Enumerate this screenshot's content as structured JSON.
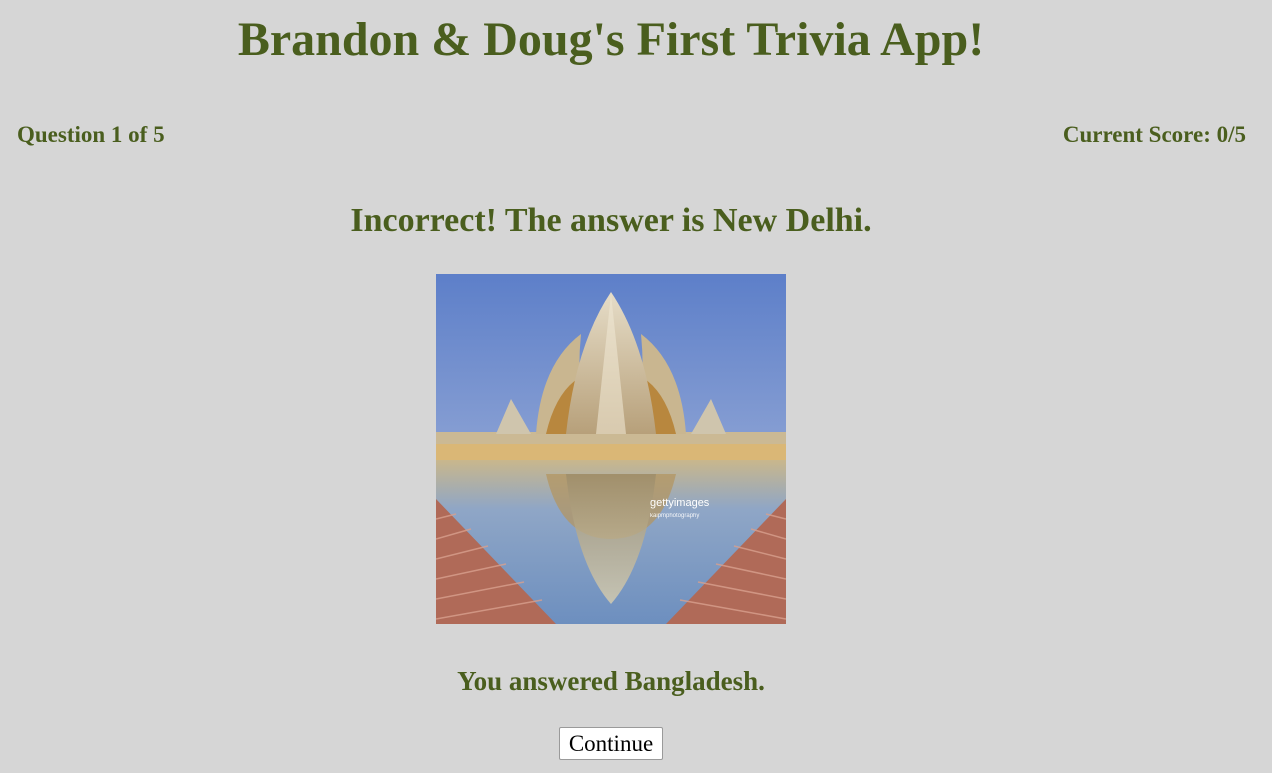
{
  "header": {
    "title": "Brandon & Doug's First Trivia App!"
  },
  "status": {
    "question_progress": "Question 1 of 5",
    "score": "Current Score: 0/5"
  },
  "feedback": {
    "result": "Incorrect! The answer is New Delhi.",
    "user_answer": "You answered Bangladesh."
  },
  "image": {
    "watermark": "gettyimages",
    "watermark_sub": "kaipmphotography"
  },
  "actions": {
    "continue_label": "Continue"
  }
}
